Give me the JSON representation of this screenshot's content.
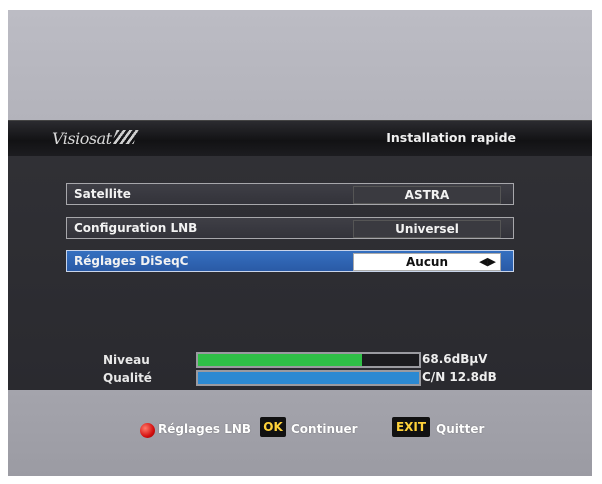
{
  "header": {
    "logo": "Visiosat",
    "title": "Installation rapide"
  },
  "rows": [
    {
      "label": "Satellite",
      "value": "ASTRA"
    },
    {
      "label": "Configuration LNB",
      "value": "Universel"
    },
    {
      "label": "Réglages DiSeqC",
      "value": "Aucun"
    }
  ],
  "meters": [
    {
      "label": "Niveau",
      "value": "68.6dBµV",
      "level": 0.74,
      "color": "#2fbf47"
    },
    {
      "label": "Qualité",
      "value": "C/N 12.8dB",
      "level": 1.0,
      "color": "#2c89d2"
    }
  ],
  "footer": {
    "red_label": "Réglages LNB",
    "ok_key": "OK",
    "ok_label": "Continuer",
    "exit_key": "EXIT",
    "exit_label": "Quitter"
  },
  "icons": {
    "selector": "left-right-arrows-icon",
    "red_button": "red-button-icon"
  }
}
